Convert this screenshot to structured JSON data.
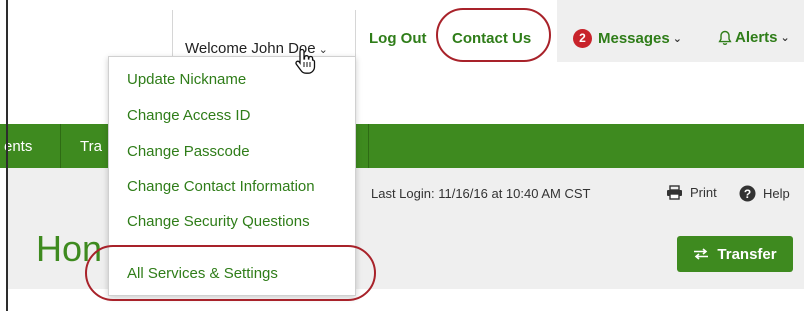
{
  "header": {
    "welcome_label": "Welcome John Doe",
    "logout_label": "Log Out",
    "contact_label": "Contact Us",
    "messages_label": "Messages",
    "messages_count": "2",
    "alerts_label": "Alerts"
  },
  "account_menu": {
    "items": [
      "Update Nickname",
      "Change Access ID",
      "Change Passcode",
      "Change Contact Information",
      "Change Security Questions",
      "All Services & Settings"
    ]
  },
  "nav": {
    "items": [
      "ents",
      "Tra"
    ]
  },
  "page": {
    "last_login": "Last Login: 11/16/16 at 10:40 AM CST",
    "print_label": "Print",
    "help_label": "Help",
    "heading": "Hon",
    "transfer_label": "Transfer"
  },
  "colors": {
    "brand_green": "#3e8a1f",
    "link_green": "#2f7d19",
    "badge_red": "#c8232b",
    "annotation_red": "#a8222a",
    "band_gray": "#efefef"
  },
  "icons": {
    "welcome_caret": "chevron-down-icon",
    "pointer": "hand-pointer-icon",
    "alerts": "bell-icon",
    "print": "printer-icon",
    "help": "help-circle-icon",
    "transfer": "transfer-arrows-icon"
  }
}
